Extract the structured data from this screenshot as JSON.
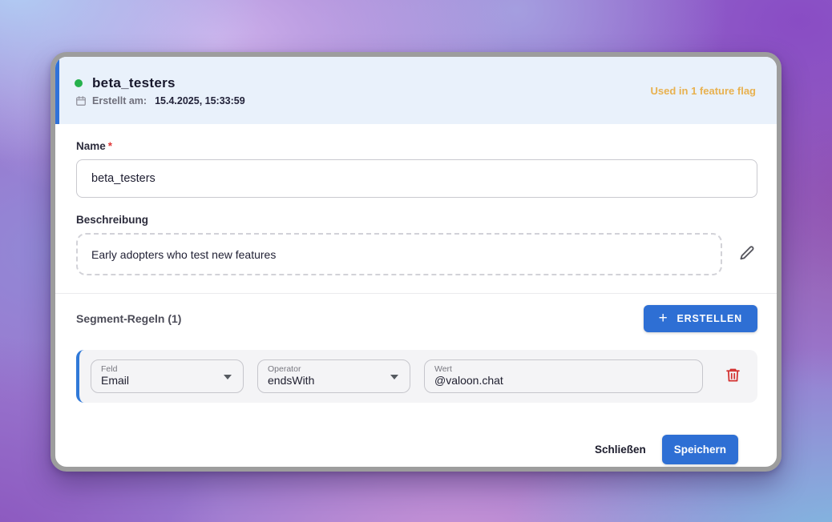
{
  "modal": {
    "header": {
      "title": "beta_testers",
      "created_label": "Erstellt am:",
      "created_value": "15.4.2025, 15:33:59",
      "usage_badge": "Used in 1 feature flag"
    },
    "form": {
      "name_label": "Name",
      "required_marker": "*",
      "name_value": "beta_testers",
      "description_label": "Beschreibung",
      "description_value": "Early adopters who test new features"
    },
    "rules": {
      "section_title": "Segment-Regeln (1)",
      "create_plus": "+",
      "create_button": "ERSTELLEN",
      "items": [
        {
          "field_label": "Feld",
          "field_value": "Email",
          "operator_label": "Operator",
          "operator_value": "endsWith",
          "value_label": "Wert",
          "value_value": "@valoon.chat"
        }
      ]
    },
    "footer": {
      "close_label": "Schließen",
      "save_label": "Speichern"
    }
  },
  "colors": {
    "accent_blue": "#2e6fd4",
    "header_background": "#e9f1fb",
    "usage_amber": "#e8b14f",
    "status_green": "#26b14c",
    "danger_red": "#d3302f"
  }
}
